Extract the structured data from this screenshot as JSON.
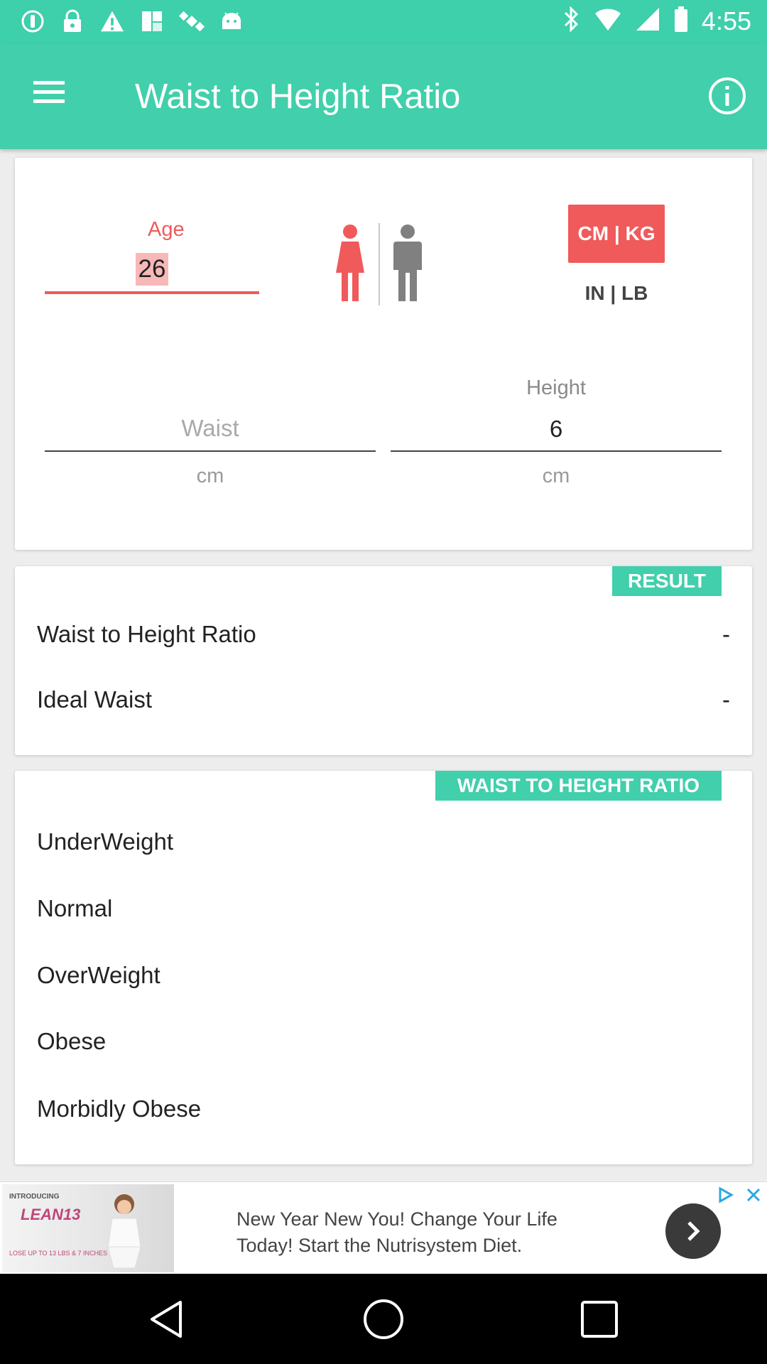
{
  "status_bar": {
    "time": "4:55",
    "left_icons": [
      "alert-icon",
      "lock-icon",
      "warning-icon",
      "fake-gps-icon",
      "satellite-icon",
      "android-icon"
    ],
    "right_icons": [
      "bluetooth-icon"
    ]
  },
  "app_bar": {
    "title": "Waist to Height Ratio"
  },
  "inputs": {
    "age_label": "Age",
    "age_value": "26",
    "unit_metric": "CM | KG",
    "unit_imperial": "IN | LB",
    "waist_placeholder": "Waist",
    "waist_unit": "cm",
    "height_label": "Height",
    "height_value": "6",
    "height_unit": "cm"
  },
  "colors": {
    "accent": "#42cfab",
    "female_selected": "#f05a5b",
    "male_unselected": "#808080"
  },
  "result": {
    "tag": "RESULT",
    "rows": [
      {
        "label": "Waist to Height Ratio",
        "value": "-"
      },
      {
        "label": "Ideal Waist",
        "value": "-"
      }
    ]
  },
  "ratio_table": {
    "tag": "WAIST TO HEIGHT RATIO",
    "rows": [
      "UnderWeight",
      "Normal",
      "OverWeight",
      "Obese",
      "Morbidly Obese"
    ]
  },
  "ad": {
    "brand_line": "INTRODUCING",
    "brand": "LEAN13",
    "promo": "LOSE UP TO 13 LBS & 7 INCHES",
    "text": "New Year New You! Change Your Life Today! Start the Nutrisystem Diet."
  }
}
